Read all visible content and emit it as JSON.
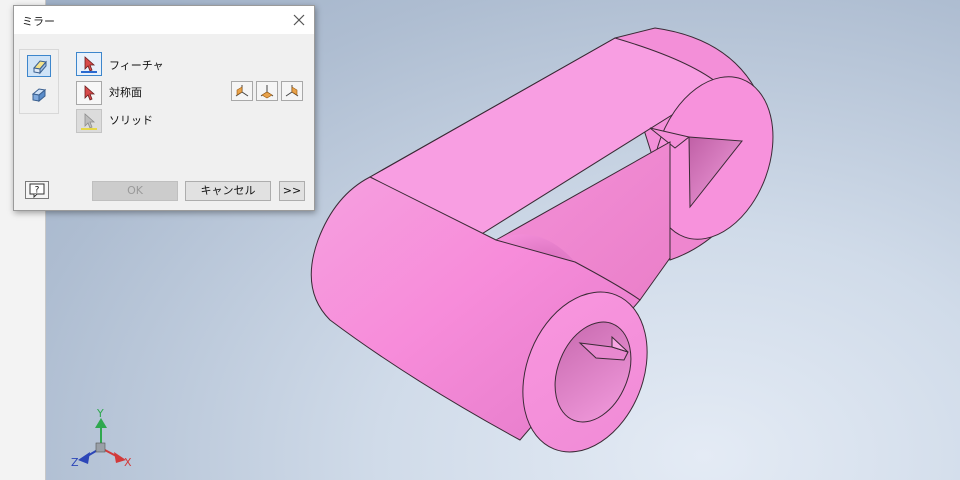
{
  "dialog": {
    "title": "ミラー",
    "close_icon": "close-icon",
    "modes": [
      {
        "name": "mirror-features-mode",
        "icon": "mirror-features-icon",
        "active": true
      },
      {
        "name": "mirror-solids-mode",
        "icon": "mirror-solids-icon",
        "active": false
      }
    ],
    "selectors": {
      "features_label": "フィーチャ",
      "plane_label": "対称面",
      "solids_label": "ソリッド"
    },
    "plane_buttons": [
      "yz-plane-icon",
      "xz-plane-icon",
      "xy-plane-icon"
    ],
    "buttons": {
      "help_icon": "help-icon",
      "ok_label": "OK",
      "cancel_label": "キャンセル",
      "more_label": ">>"
    }
  },
  "triad": {
    "x_label": "X",
    "y_label": "Y",
    "z_label": "Z",
    "x_color": "#d23a3a",
    "y_color": "#2fa84f",
    "z_color": "#2c46b8"
  },
  "model": {
    "color": "#f794dc",
    "edge_color": "#3a2a35"
  }
}
